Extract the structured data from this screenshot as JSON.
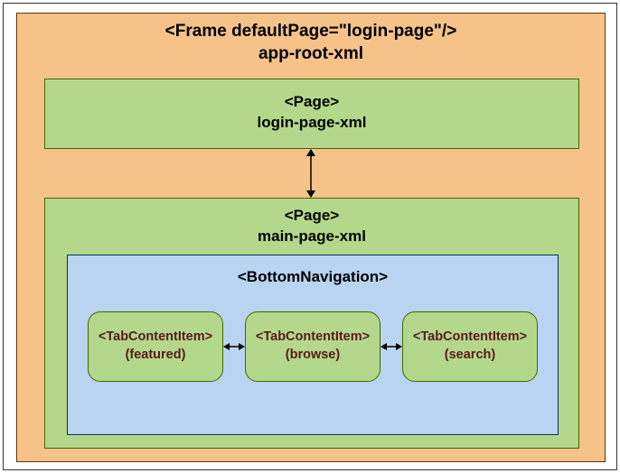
{
  "frame": {
    "title_line1": "<Frame defaultPage=\"login-page\"/>",
    "title_line2": "app-root-xml"
  },
  "loginPage": {
    "tag": "<Page>",
    "filename": "login-page-xml"
  },
  "mainPage": {
    "tag": "<Page>",
    "filename": "main-page-xml"
  },
  "bottomNav": {
    "tag": "<BottomNavigation>"
  },
  "tabs": [
    {
      "tag": "<TabContentItem>",
      "name": "(featured)"
    },
    {
      "tag": "<TabContentItem>",
      "name": "(browse)"
    },
    {
      "tag": "<TabContentItem>",
      "name": "(search)"
    }
  ]
}
